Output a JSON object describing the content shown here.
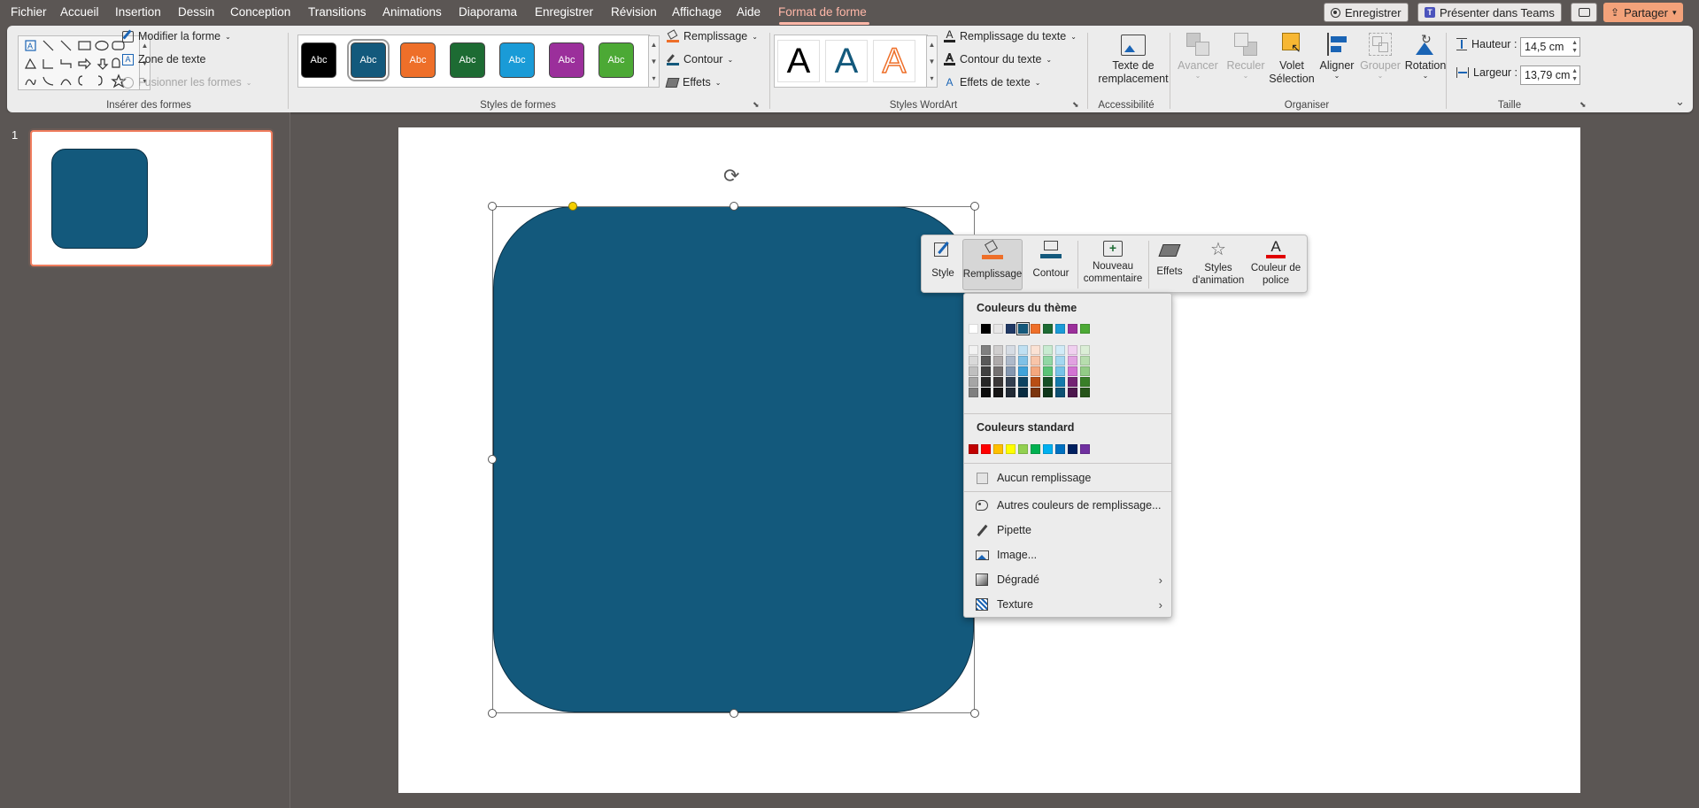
{
  "menu": {
    "items": [
      "Fichier",
      "Accueil",
      "Insertion",
      "Dessin",
      "Conception",
      "Transitions",
      "Animations",
      "Diaporama",
      "Enregistrer",
      "Révision",
      "Affichage",
      "Aide",
      "Format de forme"
    ],
    "record_button": "Enregistrer",
    "teams_button": "Présenter dans Teams",
    "share_button": "Partager"
  },
  "ribbon": {
    "insert_shapes": {
      "label": "Insérer des formes",
      "edit_shape": "Modifier la forme",
      "text_box": "Zone de texte",
      "merge_shapes": "Fusionner les formes"
    },
    "shape_styles": {
      "label": "Styles de formes",
      "tile_text": "Abc",
      "tiles": [
        "#000000",
        "#13597c",
        "#ee6f29",
        "#1d6b33",
        "#1a9bd7",
        "#9b2f9b",
        "#4ca935"
      ],
      "fill": "Remplissage",
      "outline": "Contour",
      "effects": "Effets"
    },
    "wordart": {
      "label": "Styles WordArt",
      "glyph": "A",
      "text_fill": "Remplissage du texte",
      "text_outline": "Contour du texte",
      "text_effects": "Effets de texte"
    },
    "accessibility": {
      "label": "Accessibilité",
      "alt_text_line1": "Texte de",
      "alt_text_line2": "remplacement"
    },
    "arrange": {
      "label": "Organiser",
      "forward": "Avancer",
      "backward": "Reculer",
      "pane_line1": "Volet",
      "pane_line2": "Sélection",
      "align": "Aligner",
      "group": "Grouper",
      "rotate": "Rotation"
    },
    "size": {
      "label": "Taille",
      "height_label": "Hauteur :",
      "height_value": "14,5 cm",
      "width_label": "Largeur :",
      "width_value": "13,79 cm"
    }
  },
  "slides": {
    "number": "1"
  },
  "shape": {
    "color": "#13597c"
  },
  "mini_toolbar": {
    "style": "Style",
    "fill": "Remplissage",
    "outline": "Contour",
    "comment_line1": "Nouveau",
    "comment_line2": "commentaire",
    "effects": "Effets",
    "anim_line1": "Styles",
    "anim_line2": "d'animation",
    "font_color_line1": "Couleur de",
    "font_color_line2": "police"
  },
  "fill_menu": {
    "theme_colors_title": "Couleurs du thème",
    "theme_colors": [
      "#ffffff",
      "#000000",
      "#e7e6e6",
      "#1f3864",
      "#13597c",
      "#ee6f29",
      "#1d6b33",
      "#1a9bd7",
      "#9b2f9b",
      "#4ca935"
    ],
    "shade_columns": [
      [
        "#f2f2f2",
        "#d9d9d9",
        "#bfbfbf",
        "#a6a6a6",
        "#808080"
      ],
      [
        "#808080",
        "#595959",
        "#404040",
        "#262626",
        "#0d0d0d"
      ],
      [
        "#d0cece",
        "#aeaaaa",
        "#757171",
        "#3b3838",
        "#171616"
      ],
      [
        "#d6dce4",
        "#adb9ca",
        "#8497b0",
        "#333f50",
        "#222a35"
      ],
      [
        "#bfe0f2",
        "#7fc1e6",
        "#3fa2d9",
        "#0e4362",
        "#092c41"
      ],
      [
        "#fbe2d4",
        "#f8c5a9",
        "#f4a87e",
        "#b94e14",
        "#7b340d"
      ],
      [
        "#c8ebd1",
        "#91d7a4",
        "#5ac376",
        "#165026",
        "#0e361a"
      ],
      [
        "#d1ebf7",
        "#a3d7f0",
        "#76c3e8",
        "#137aab",
        "#0d5172"
      ],
      [
        "#f0d0f0",
        "#e1a1e1",
        "#d272d2",
        "#742374",
        "#4d174d"
      ],
      [
        "#dbeed6",
        "#b7ddae",
        "#93cc86",
        "#397f28",
        "#26541a"
      ]
    ],
    "standard_colors_title": "Couleurs standard",
    "standard_colors": [
      "#c00000",
      "#ff0000",
      "#ffc000",
      "#ffff00",
      "#92d050",
      "#00b050",
      "#00b0f0",
      "#0070c0",
      "#002060",
      "#7030a0"
    ],
    "no_fill": "Aucun remplissage",
    "more_colors": "Autres couleurs de remplissage...",
    "eyedropper": "Pipette",
    "picture": "Image...",
    "gradient": "Dégradé",
    "texture": "Texture"
  }
}
